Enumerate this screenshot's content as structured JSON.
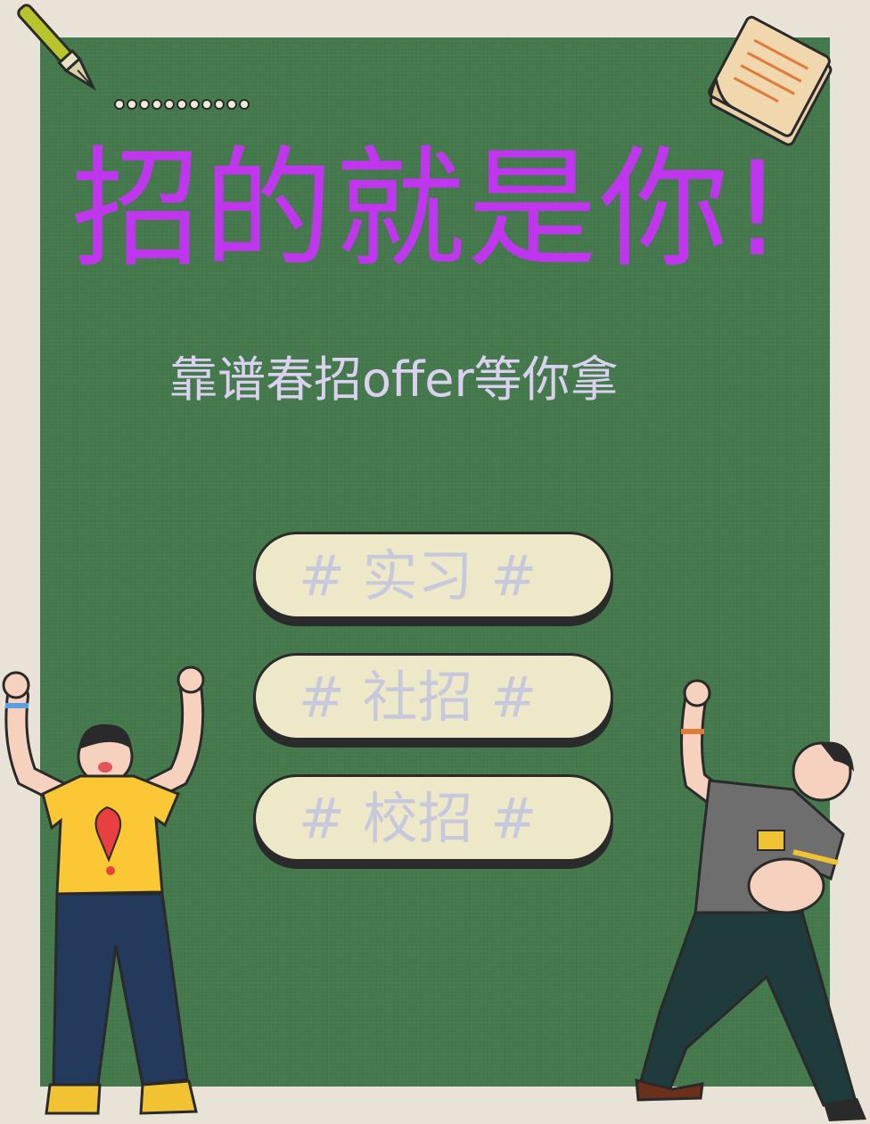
{
  "title": "招的就是你!",
  "subtitle": "靠谱春招offer等你拿",
  "tags": [
    {
      "label": "# 实习 #"
    },
    {
      "label": "# 社招 #"
    },
    {
      "label": "# 校招 #"
    }
  ],
  "colors": {
    "background": "#e8e3d6",
    "board": "#457a4d",
    "title": "#c035ee",
    "subtitle": "#dcd0f0",
    "pill_fill": "#ece8c8",
    "pill_text": "#c7c8dc"
  },
  "icons": {
    "pen": "fountain-pen-icon",
    "paper": "paper-notes-icon",
    "left_person": "cheering-boy-illustration",
    "right_person": "pointing-man-illustration"
  }
}
